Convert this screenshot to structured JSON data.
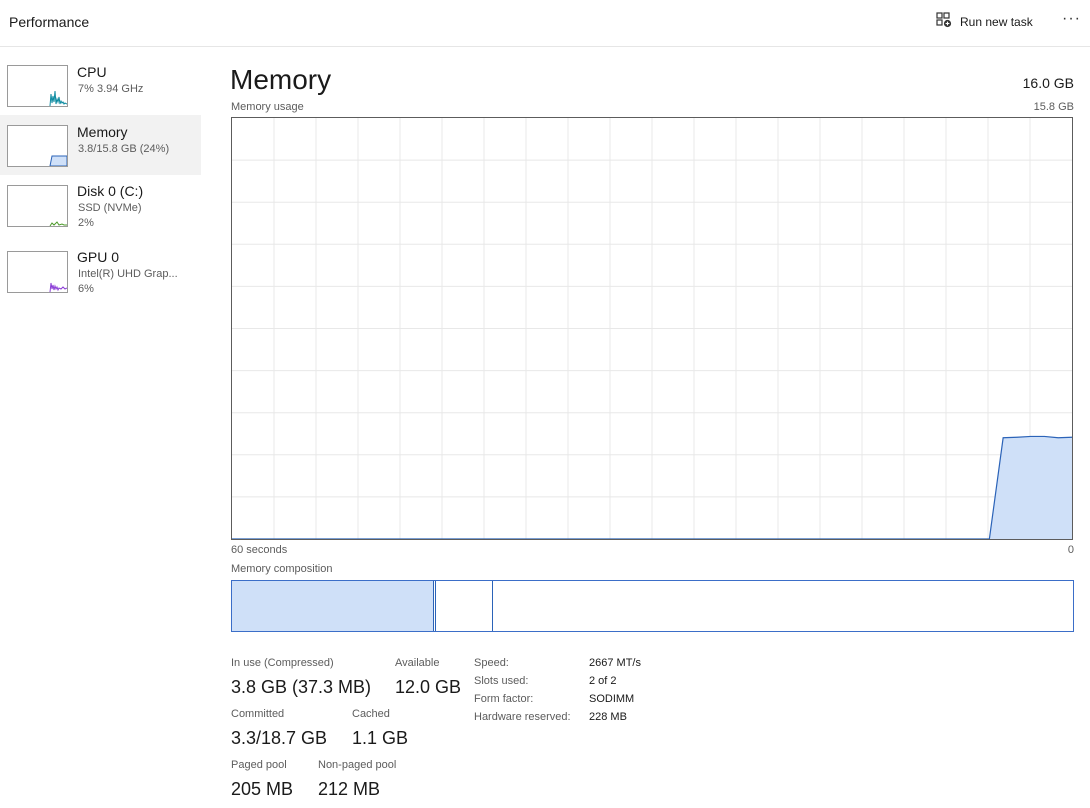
{
  "header": {
    "title": "Performance",
    "run_task_label": "Run new task",
    "more_label": "···"
  },
  "sidebar": {
    "items": [
      {
        "name": "CPU",
        "line1": "7%  3.94 GHz",
        "line2": "",
        "color": "#0b8aa0",
        "selected": false
      },
      {
        "name": "Memory",
        "line1": "3.8/15.8 GB (24%)",
        "line2": "",
        "color": "#2b63b8",
        "selected": true
      },
      {
        "name": "Disk 0 (C:)",
        "line1": "SSD (NVMe)",
        "line2": "2%",
        "color": "#4c9a2a",
        "selected": false
      },
      {
        "name": "GPU 0",
        "line1": "Intel(R) UHD Grap...",
        "line2": "6%",
        "color": "#8a3bd6",
        "selected": false
      }
    ]
  },
  "main": {
    "title": "Memory",
    "total": "16.0 GB",
    "usage_label": "Memory usage",
    "usage_max": "15.8 GB",
    "time_left": "60 seconds",
    "time_right": "0",
    "composition_label": "Memory composition"
  },
  "stats": {
    "in_use_label": "In use (Compressed)",
    "in_use_value": "3.8 GB (37.3 MB)",
    "available_label": "Available",
    "available_value": "12.0 GB",
    "committed_label": "Committed",
    "committed_value": "3.3/18.7 GB",
    "cached_label": "Cached",
    "cached_value": "1.1 GB",
    "paged_label": "Paged pool",
    "paged_value": "205 MB",
    "nonpaged_label": "Non-paged pool",
    "nonpaged_value": "212 MB"
  },
  "info": {
    "speed_label": "Speed:",
    "speed_value": "2667 MT/s",
    "slots_label": "Slots used:",
    "slots_value": "2 of 2",
    "form_label": "Form factor:",
    "form_value": "SODIMM",
    "reserved_label": "Hardware reserved:",
    "reserved_value": "228 MB"
  },
  "colors": {
    "accent": "#2b63b8",
    "fill": "#cfe0f8",
    "grid": "#e8e8e8"
  },
  "chart_data": {
    "type": "area",
    "x_range_seconds": [
      60,
      0
    ],
    "ylim_gb": [
      0,
      15.8
    ],
    "series": [
      {
        "values_gb": [
          0,
          0,
          0,
          0,
          0,
          0,
          0,
          0,
          0,
          0,
          0,
          0,
          0,
          0,
          0,
          0,
          0,
          0,
          0,
          0,
          0,
          0,
          0,
          0,
          0,
          0,
          0,
          0,
          0,
          0,
          0,
          0,
          0,
          0,
          0,
          0,
          0,
          0,
          0,
          0,
          0,
          0,
          0,
          0,
          0,
          0,
          0,
          0,
          0,
          0,
          0,
          0,
          0,
          0,
          0,
          0,
          3.8,
          3.82,
          3.85,
          3.85,
          3.8,
          3.82
        ]
      }
    ],
    "composition": [
      {
        "segment": "In use",
        "fraction": 0.24
      },
      {
        "segment": "Modified",
        "fraction": 0.003
      },
      {
        "segment": "Standby",
        "fraction": 0.067
      },
      {
        "segment": "Free",
        "fraction": 0.69
      }
    ]
  }
}
